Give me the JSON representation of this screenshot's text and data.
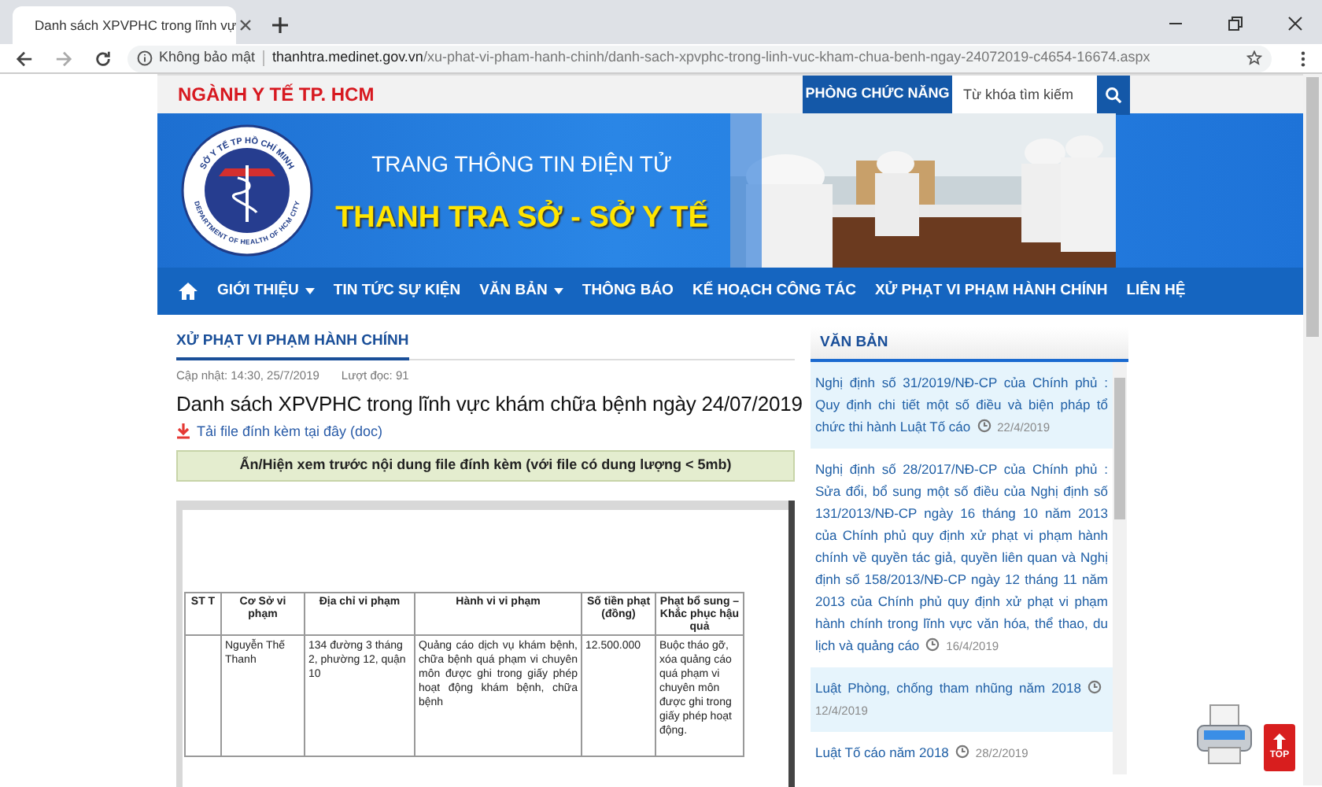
{
  "browser": {
    "tab_title": "Danh sách XPVPHC trong lĩnh vự",
    "security": "Không bảo mật",
    "url_host": "thanhtra.medinet.gov.vn",
    "url_path": "/xu-phat-vi-pham-hanh-chinh/danh-sach-xpvphc-trong-linh-vuc-kham-chua-benh-ngay-24072019-c4654-16674.aspx"
  },
  "topbar": {
    "brand": "NGÀNH Y TẾ TP. HCM",
    "functions_button": "PHÒNG CHỨC NĂNG",
    "search": {
      "placeholder": "Từ khóa tìm kiếm"
    }
  },
  "banner": {
    "logo_top": "SỞ Y TẾ TP HỒ CHÍ MINH",
    "logo_bottom": "DEPARTMENT OF HEALTH OF HCM CITY",
    "subtitle": "TRANG THÔNG TIN ĐIỆN TỬ",
    "title": "THANH TRA SỞ - SỞ Y TẾ"
  },
  "nav": [
    {
      "label": "GIỚI THIỆU",
      "has_menu": true
    },
    {
      "label": "TIN TỨC SỰ KIỆN",
      "has_menu": false
    },
    {
      "label": "VĂN BẢN",
      "has_menu": true
    },
    {
      "label": "THÔNG BÁO",
      "has_menu": false
    },
    {
      "label": "KẾ HOẠCH CÔNG TÁC",
      "has_menu": false
    },
    {
      "label": "XỬ PHẠT VI PHẠM HÀNH CHÍNH",
      "has_menu": false
    },
    {
      "label": "LIÊN HỆ",
      "has_menu": false
    }
  ],
  "article": {
    "category": "XỬ PHẠT VI PHẠM HÀNH CHÍNH",
    "updated": "Cập nhật: 14:30, 25/7/2019",
    "views": "Lượt đọc: 91",
    "title": "Danh sách XPVPHC trong lĩnh vực khám chữa bệnh ngày 24/07/2019",
    "download": "Tải file đính kèm tại đây (doc)",
    "preview_toggle": "Ẩn/Hiện xem trước nội dung file đính kèm (với file có dung lượng < 5mb)"
  },
  "document": {
    "columns": [
      "ST T",
      "Cơ Sở vi phạm",
      "Địa chỉ vi phạm",
      "Hành vi vi phạm",
      "Số tiền phạt (đồng)",
      "Phạt bổ sung – Khắc phục hậu quả"
    ],
    "rows": [
      [
        "",
        "Nguyễn Thế Thanh",
        "134 đường 3 tháng 2, phường 12, quận 10",
        "Quảng cáo dịch vụ khám bệnh, chữa bệnh quá phạm vi chuyên môn được ghi trong giấy phép hoạt động khám bệnh, chữa bệnh",
        "12.500.000",
        "Buộc tháo gỡ, xóa quảng cáo quá phạm vi chuyên môn được ghi trong giấy phép hoạt động."
      ]
    ]
  },
  "sidebar": {
    "title": "VĂN BẢN",
    "items": [
      {
        "text": "Nghị định số 31/2019/NĐ-CP của Chính phủ : Quy định chi tiết một số điều và biện pháp tổ chức thi hành Luật Tố cáo",
        "date": "22/4/2019"
      },
      {
        "text": "Nghị định số 28/2017/NĐ-CP của Chính phủ : Sửa đổi, bổ sung một số điều của Nghị định số 131/2013/NĐ-CP ngày 16 tháng 10 năm 2013 của Chính phủ quy định xử phạt vi phạm hành chính về quyền tác giả, quyền liên quan và Nghị định số 158/2013/NĐ-CP ngày 12 tháng 11 năm 2013 của Chính phủ quy định xử phạt vi phạm hành chính trong lĩnh vực văn hóa, thể thao, du lịch và quảng cáo",
        "date": "16/4/2019"
      },
      {
        "text": "Luật Phòng, chống tham nhũng năm 2018",
        "date": "12/4/2019"
      },
      {
        "text": "Luật Tố cáo năm 2018",
        "date": "28/2/2019"
      }
    ]
  },
  "top_button": "TOP"
}
